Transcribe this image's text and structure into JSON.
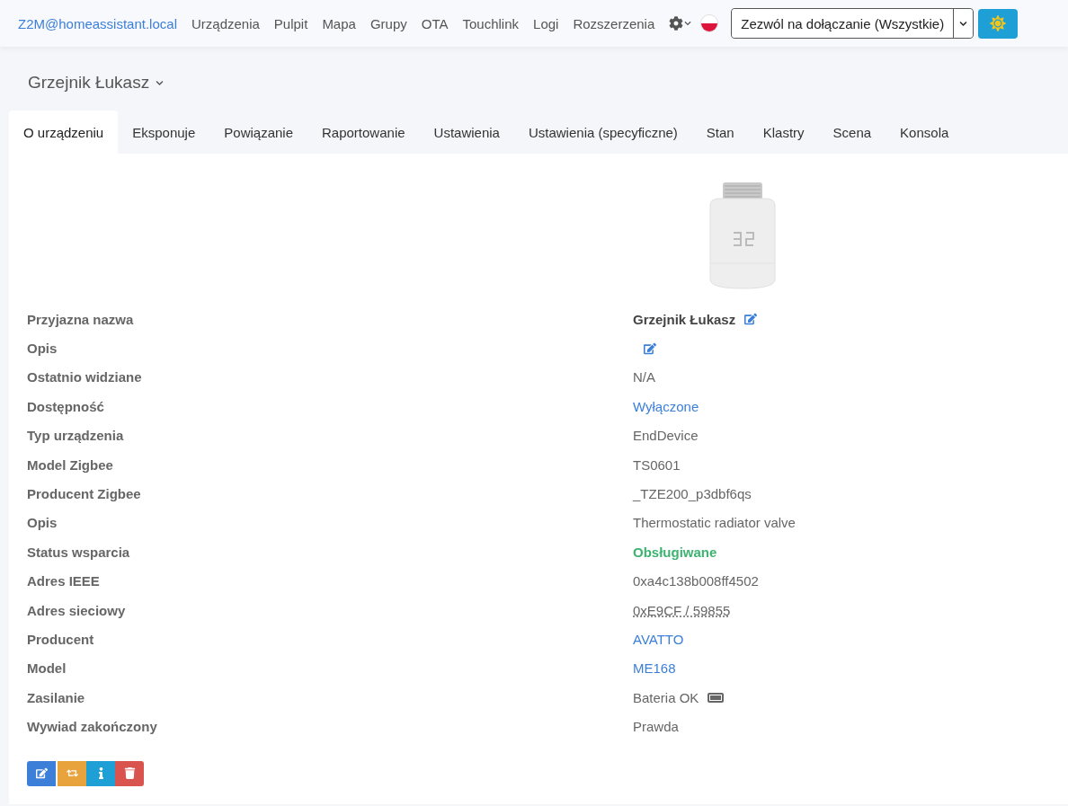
{
  "nav": {
    "brand": "Z2M@homeassistant.local",
    "links": [
      "Urządzenia",
      "Pulpit",
      "Mapa",
      "Grupy",
      "OTA",
      "Touchlink",
      "Logi",
      "Rozszerzenia"
    ],
    "permit_join": "Zezwól na dołączanie (Wszystkie)"
  },
  "device_title": "Grzejnik Łukasz",
  "tabs": [
    {
      "label": "O urządzeniu",
      "selected": true
    },
    {
      "label": "Eksponuje",
      "selected": false
    },
    {
      "label": "Powiązanie",
      "selected": false
    },
    {
      "label": "Raportowanie",
      "selected": false
    },
    {
      "label": "Ustawienia",
      "selected": false
    },
    {
      "label": "Ustawienia (specyficzne)",
      "selected": false
    },
    {
      "label": "Stan",
      "selected": false
    },
    {
      "label": "Klastry",
      "selected": false
    },
    {
      "label": "Scena",
      "selected": false
    },
    {
      "label": "Konsola",
      "selected": false
    }
  ],
  "details": [
    {
      "label": "Przyjazna nazwa",
      "kind": "name",
      "value": "Grzejnik Łukasz"
    },
    {
      "label": "Opis",
      "kind": "edit"
    },
    {
      "label": "Ostatnio widziane",
      "kind": "plain",
      "value": "N/A"
    },
    {
      "label": "Dostępność",
      "kind": "link",
      "value": "Wyłączone"
    },
    {
      "label": "Typ urządzenia",
      "kind": "plain",
      "value": "EndDevice"
    },
    {
      "label": "Model Zigbee",
      "kind": "plain",
      "value": "TS0601"
    },
    {
      "label": "Producent Zigbee",
      "kind": "plain",
      "value": "_TZE200_p3dbf6qs"
    },
    {
      "label": "Opis",
      "kind": "plain",
      "value": "Thermostatic radiator valve"
    },
    {
      "label": "Status wsparcia",
      "kind": "success",
      "value": "Obsługiwane"
    },
    {
      "label": "Adres IEEE",
      "kind": "plain",
      "value": "0xa4c138b008ff4502"
    },
    {
      "label": "Adres sieciowy",
      "kind": "abbr",
      "value": "0xE9CF / 59855"
    },
    {
      "label": "Producent",
      "kind": "link",
      "value": "AVATTO"
    },
    {
      "label": "Model",
      "kind": "link",
      "value": "ME168"
    },
    {
      "label": "Zasilanie",
      "kind": "battery",
      "value": "Bateria OK"
    },
    {
      "label": "Wywiad zakończony",
      "kind": "plain",
      "value": "Prawda"
    }
  ],
  "actions": [
    {
      "kind": "edit"
    },
    {
      "kind": "swap"
    },
    {
      "kind": "info"
    },
    {
      "kind": "delete"
    }
  ]
}
